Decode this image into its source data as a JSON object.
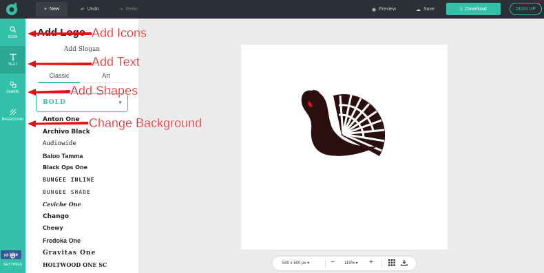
{
  "topbar": {
    "new_label": "New",
    "undo_label": "Undo",
    "redo_label": "Redo",
    "preview_label": "Preview",
    "save_label": "Save",
    "download_label": "Download",
    "signup_label": "SIGN UP"
  },
  "rail": {
    "items": [
      {
        "label": "ICON",
        "icon": "search-icon"
      },
      {
        "label": "TEXT",
        "icon": "text-icon"
      },
      {
        "label": "SHAPE",
        "icon": "shapes-icon"
      },
      {
        "label": "BKGROUND",
        "icon": "background-icon"
      }
    ],
    "like_label": "Like",
    "settings_label": "SETTINGS"
  },
  "panel": {
    "brand_name": "Add Logo",
    "slogan": "Add Slogan",
    "tabs": [
      "Classic",
      "Art"
    ],
    "selected_font": "BOLD",
    "fonts": [
      "Anton One",
      "Archivo Black",
      "Audiowide",
      "Baloo Tamma",
      "Black Ops One",
      "BUNGEE INLINE",
      "BUNGEE SHADE",
      "Ceviche One",
      "Chango",
      "Chewy",
      "Fredoka One",
      "Gravitas One",
      "HOLTWOOD ONE SC"
    ]
  },
  "canvas": {
    "size_label": "500 x 500 px",
    "zoom_label": "119%"
  },
  "annotations": {
    "icons": "Add Icons",
    "text": "Add Text",
    "shapes": "Add Shapes",
    "background": "Change Background"
  },
  "colors": {
    "accent": "#33c1a9",
    "topbar": "#2c2f35",
    "turkey": "#2b0f0f",
    "wattle": "#e01818",
    "annotation": "#e81010"
  }
}
